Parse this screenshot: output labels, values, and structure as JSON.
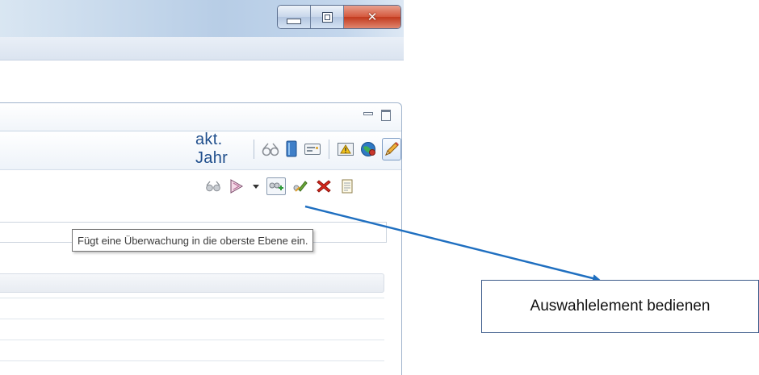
{
  "view": {
    "year_label": "akt. Jahr"
  },
  "tooltip": {
    "text": "Fügt eine Überwachung in die oberste Ebene ein."
  },
  "callout": {
    "text": "Auswahlelement bedienen"
  },
  "colors": {
    "accent": "#1f4e8c",
    "arrow": "#1f6fc0",
    "close_button": "#c9452a"
  },
  "icons": {
    "toolbar1": [
      "glasses-icon",
      "book-icon",
      "card-icon",
      "warning-icon",
      "globe-icon",
      "pencil-icon"
    ],
    "toolbar2": [
      "glasses-small-icon",
      "funnel-icon",
      "dropdown-arrow-icon",
      "add-watch-icon",
      "edit-watch-icon",
      "delete-icon",
      "document-icon"
    ]
  }
}
